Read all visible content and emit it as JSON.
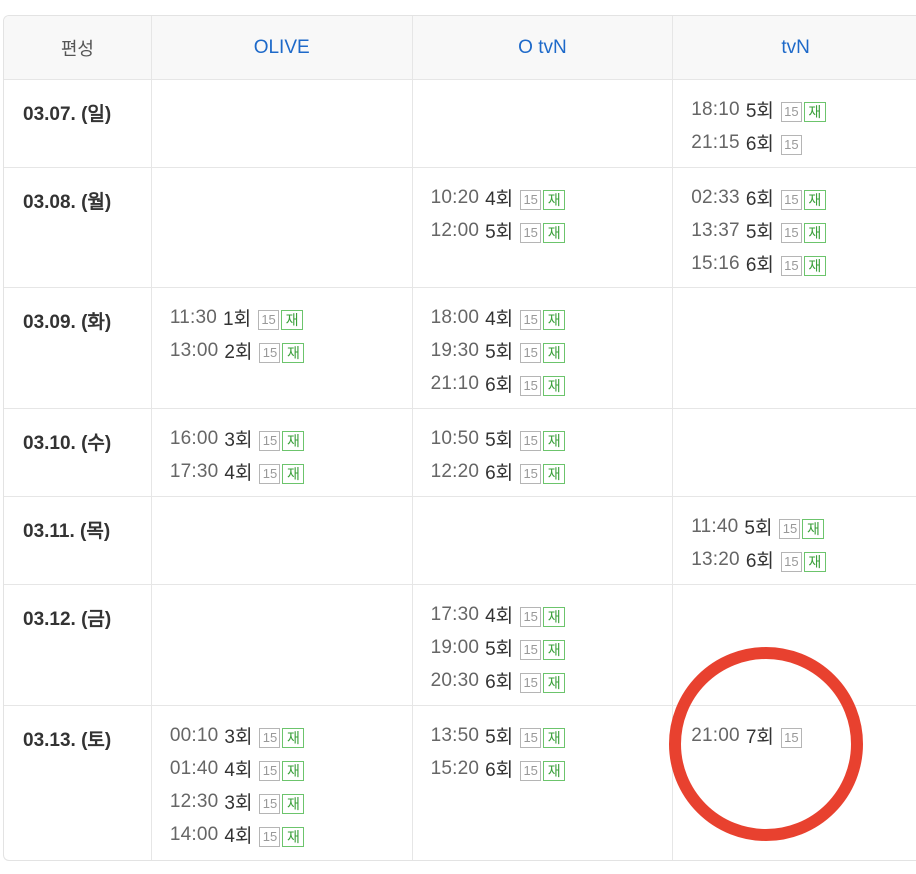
{
  "header": {
    "date_col": "편성",
    "channels": [
      "OLIVE",
      "O tvN",
      "tvN"
    ]
  },
  "rows": [
    {
      "date": "03.07. (일)",
      "channels": [
        [],
        [],
        [
          {
            "time": "18:10",
            "episode": "5회",
            "rating": "15",
            "rerun": "재"
          },
          {
            "time": "21:15",
            "episode": "6회",
            "rating": "15",
            "rerun": ""
          }
        ]
      ]
    },
    {
      "date": "03.08. (월)",
      "channels": [
        [],
        [
          {
            "time": "10:20",
            "episode": "4회",
            "rating": "15",
            "rerun": "재"
          },
          {
            "time": "12:00",
            "episode": "5회",
            "rating": "15",
            "rerun": "재"
          }
        ],
        [
          {
            "time": "02:33",
            "episode": "6회",
            "rating": "15",
            "rerun": "재"
          },
          {
            "time": "13:37",
            "episode": "5회",
            "rating": "15",
            "rerun": "재"
          },
          {
            "time": "15:16",
            "episode": "6회",
            "rating": "15",
            "rerun": "재"
          }
        ]
      ]
    },
    {
      "date": "03.09. (화)",
      "channels": [
        [
          {
            "time": "11:30",
            "episode": "1회",
            "rating": "15",
            "rerun": "재"
          },
          {
            "time": "13:00",
            "episode": "2회",
            "rating": "15",
            "rerun": "재"
          }
        ],
        [
          {
            "time": "18:00",
            "episode": "4회",
            "rating": "15",
            "rerun": "재"
          },
          {
            "time": "19:30",
            "episode": "5회",
            "rating": "15",
            "rerun": "재"
          },
          {
            "time": "21:10",
            "episode": "6회",
            "rating": "15",
            "rerun": "재"
          }
        ],
        []
      ]
    },
    {
      "date": "03.10. (수)",
      "channels": [
        [
          {
            "time": "16:00",
            "episode": "3회",
            "rating": "15",
            "rerun": "재"
          },
          {
            "time": "17:30",
            "episode": "4회",
            "rating": "15",
            "rerun": "재"
          }
        ],
        [
          {
            "time": "10:50",
            "episode": "5회",
            "rating": "15",
            "rerun": "재"
          },
          {
            "time": "12:20",
            "episode": "6회",
            "rating": "15",
            "rerun": "재"
          }
        ],
        []
      ]
    },
    {
      "date": "03.11. (목)",
      "channels": [
        [],
        [],
        [
          {
            "time": "11:40",
            "episode": "5회",
            "rating": "15",
            "rerun": "재"
          },
          {
            "time": "13:20",
            "episode": "6회",
            "rating": "15",
            "rerun": "재"
          }
        ]
      ]
    },
    {
      "date": "03.12. (금)",
      "channels": [
        [],
        [
          {
            "time": "17:30",
            "episode": "4회",
            "rating": "15",
            "rerun": "재"
          },
          {
            "time": "19:00",
            "episode": "5회",
            "rating": "15",
            "rerun": "재"
          },
          {
            "time": "20:30",
            "episode": "6회",
            "rating": "15",
            "rerun": "재"
          }
        ],
        []
      ]
    },
    {
      "date": "03.13. (토)",
      "channels": [
        [
          {
            "time": "00:10",
            "episode": "3회",
            "rating": "15",
            "rerun": "재"
          },
          {
            "time": "01:40",
            "episode": "4회",
            "rating": "15",
            "rerun": "재"
          },
          {
            "time": "12:30",
            "episode": "3회",
            "rating": "15",
            "rerun": "재"
          },
          {
            "time": "14:00",
            "episode": "4회",
            "rating": "15",
            "rerun": "재"
          }
        ],
        [
          {
            "time": "13:50",
            "episode": "5회",
            "rating": "15",
            "rerun": "재"
          },
          {
            "time": "15:20",
            "episode": "6회",
            "rating": "15",
            "rerun": "재"
          }
        ],
        [
          {
            "time": "21:00",
            "episode": "7회",
            "rating": "15",
            "rerun": ""
          }
        ]
      ]
    }
  ],
  "colors": {
    "channel_header": "#1d69c9",
    "rerun_badge": "#3a9f3a",
    "annotation_circle": "#e8412f"
  }
}
